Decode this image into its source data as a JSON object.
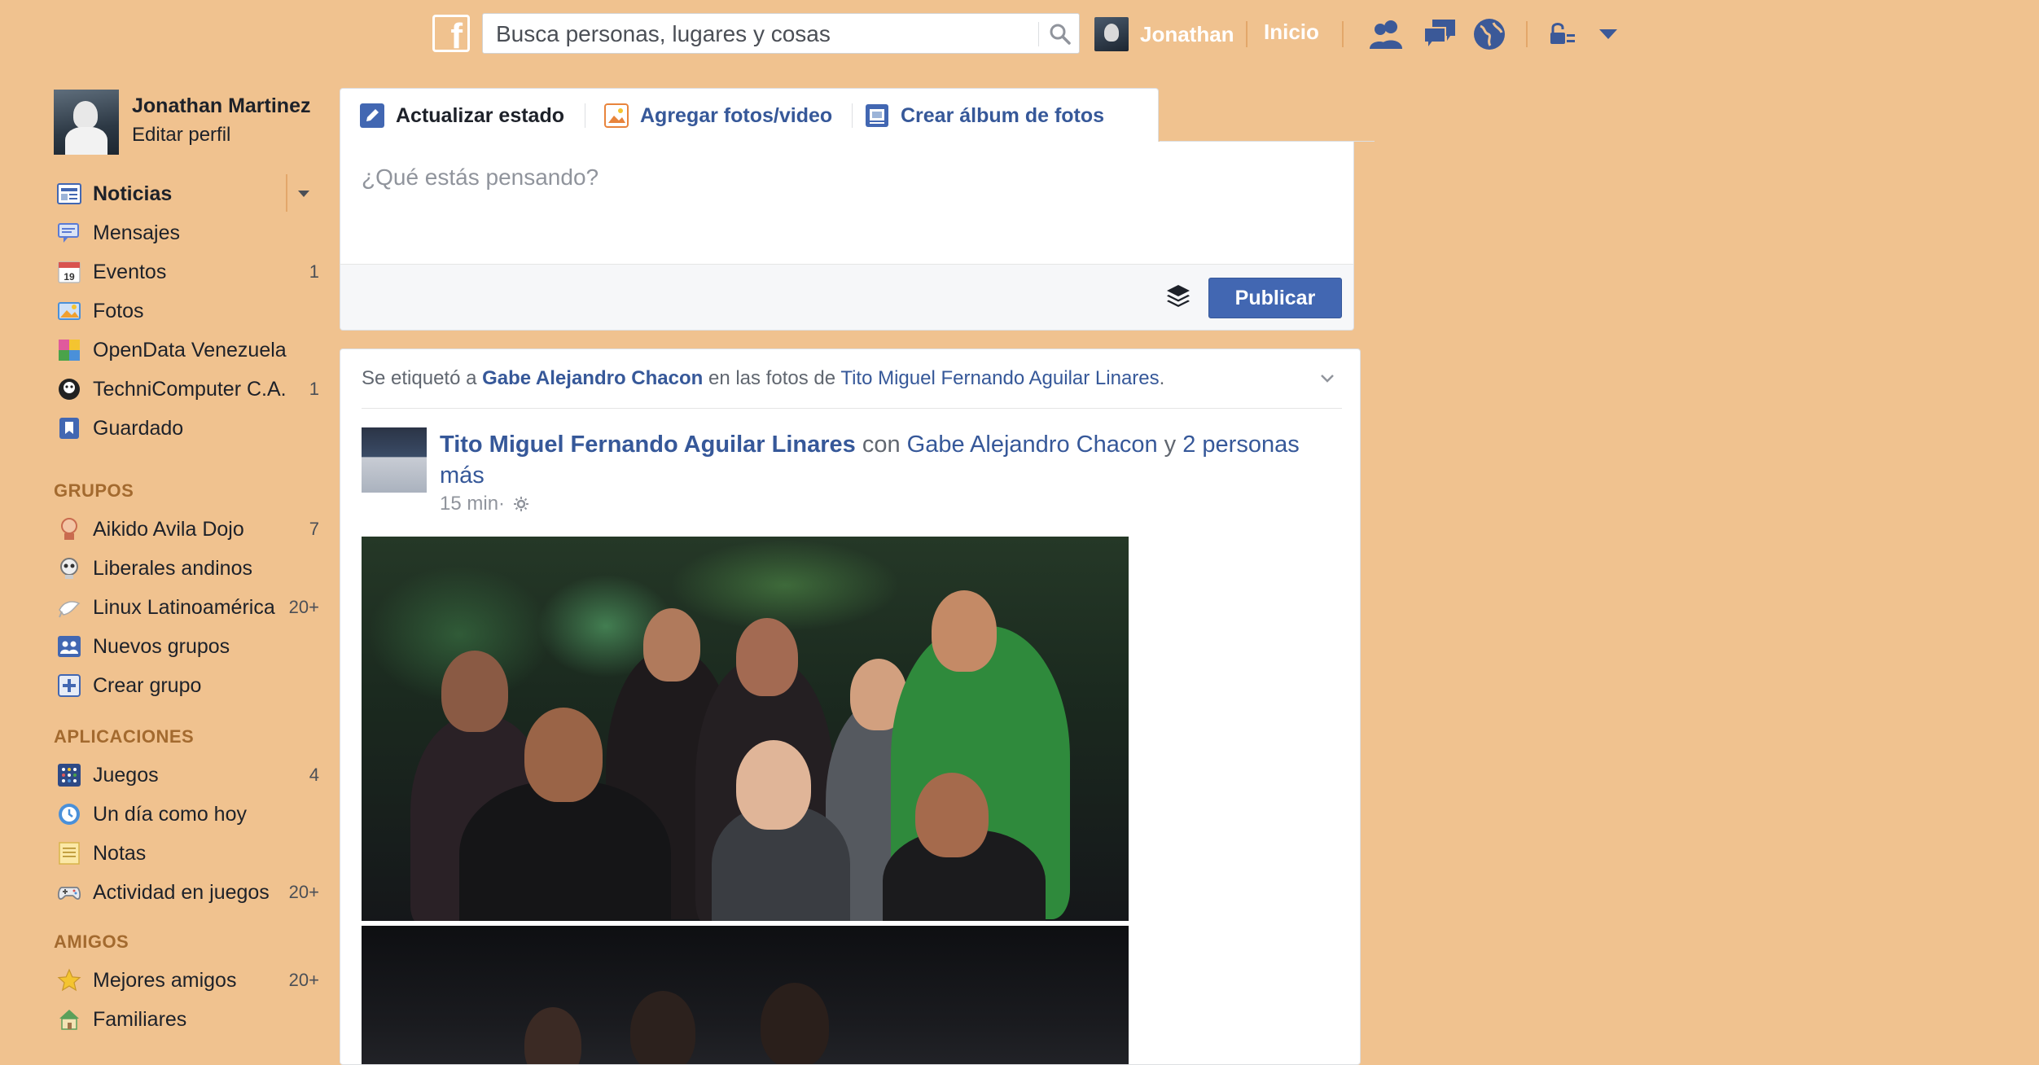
{
  "topbar": {
    "logo_letter": "f",
    "search_placeholder": "Busca personas, lugares y cosas",
    "user_name": "Jonathan",
    "home_label": "Inicio",
    "icons": [
      "friend-requests-icon",
      "messages-icon",
      "notifications-globe-icon",
      "privacy-shortcuts-icon",
      "account-menu-caret-icon"
    ]
  },
  "sidebar": {
    "profile": {
      "name": "Jonathan Martinez",
      "edit_label": "Editar perfil"
    },
    "main_items": [
      {
        "label": "Noticias",
        "count": "",
        "icon": "news-feed-icon",
        "color": "#4267b2"
      },
      {
        "label": "Mensajes",
        "count": "",
        "icon": "messages-icon",
        "color": "#5b7bd5"
      },
      {
        "label": "Eventos",
        "count": "1",
        "icon": "calendar-icon",
        "color": "#d9534f"
      },
      {
        "label": "Fotos",
        "count": "",
        "icon": "photos-icon",
        "color": "#4a90d9"
      },
      {
        "label": "OpenData Venezuela",
        "count": "",
        "icon": "page-icon",
        "color": "#e05a9d"
      },
      {
        "label": "TechniComputer C.A.",
        "count": "1",
        "icon": "page-icon",
        "color": "#222222"
      },
      {
        "label": "Guardado",
        "count": "",
        "icon": "bookmark-icon",
        "color": "#4267b2"
      }
    ],
    "groups_header": "GRUPOS",
    "groups": [
      {
        "label": "Aikido Avila Dojo",
        "count": "7",
        "icon": "group-icon",
        "color": "#c96b4f"
      },
      {
        "label": "Liberales andinos",
        "count": "",
        "icon": "group-icon",
        "color": "#888888"
      },
      {
        "label": "Linux Latinoamérica",
        "count": "20+",
        "icon": "group-icon",
        "color": "#bbbbbb"
      },
      {
        "label": "Nuevos grupos",
        "count": "",
        "icon": "new-groups-icon",
        "color": "#4267b2"
      },
      {
        "label": "Crear grupo",
        "count": "",
        "icon": "create-group-icon",
        "color": "#4267b2"
      }
    ],
    "apps_header": "APLICACIONES",
    "apps": [
      {
        "label": "Juegos",
        "count": "4",
        "icon": "games-icon",
        "color": "#3b5998"
      },
      {
        "label": "Un día como hoy",
        "count": "",
        "icon": "on-this-day-icon",
        "color": "#4a90d9"
      },
      {
        "label": "Notas",
        "count": "",
        "icon": "notes-icon",
        "color": "#f1d27a"
      },
      {
        "label": "Actividad en juegos",
        "count": "20+",
        "icon": "game-activity-icon",
        "color": "#7a7f88"
      }
    ],
    "friends_header": "AMIGOS",
    "friends": [
      {
        "label": "Mejores amigos",
        "count": "20+",
        "icon": "star-icon",
        "color": "#f4c430"
      },
      {
        "label": "Familiares",
        "count": "",
        "icon": "family-icon",
        "color": "#5aa05a"
      }
    ]
  },
  "composer": {
    "tabs": [
      {
        "label": "Actualizar estado",
        "icon": "pencil-icon"
      },
      {
        "label": "Agregar fotos/video",
        "icon": "photo-icon"
      },
      {
        "label": "Crear álbum de fotos",
        "icon": "album-icon"
      }
    ],
    "placeholder": "¿Qué estás pensando?",
    "publish_label": "Publicar"
  },
  "story": {
    "context": {
      "prefix": "Se etiquetó a ",
      "tagged": "Gabe Alejandro Chacon",
      "middle": " en las fotos de ",
      "owner": "Tito Miguel Fernando Aguilar Linares",
      "suffix": "."
    },
    "author": "Tito Miguel Fernando Aguilar Linares",
    "with_word": " con ",
    "with_name": "Gabe Alejandro Chacon",
    "and_word": " y ",
    "others": "2 personas más",
    "time": "15 min",
    "dot": " · "
  },
  "colors": {
    "background": "#f0c28f",
    "link": "#365899",
    "publish_button": "#4267b2"
  }
}
